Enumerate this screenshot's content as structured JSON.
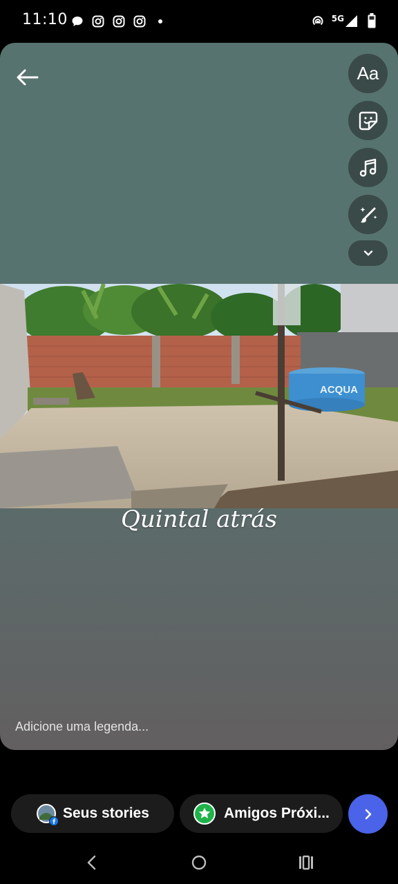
{
  "status_bar": {
    "time": "11:10",
    "network": "5G",
    "left_icons": [
      "chat-bubble-icon",
      "instagram-icon",
      "instagram-icon",
      "instagram-icon",
      "dot-icon"
    ],
    "right_icons": [
      "hotspot-icon",
      "signal-icon",
      "battery-icon"
    ]
  },
  "editor": {
    "tools": [
      {
        "name": "text-tool",
        "label": "Aa"
      },
      {
        "name": "sticker-tool",
        "icon": "sticker-icon"
      },
      {
        "name": "music-tool",
        "icon": "music-note-icon"
      },
      {
        "name": "effects-tool",
        "icon": "magic-brush-icon"
      },
      {
        "name": "more-tools",
        "icon": "chevron-down-icon"
      }
    ],
    "photo": {
      "description_icon": "photo",
      "tank_text": "ACQUA"
    },
    "overlay_text": "Quintal atrás",
    "caption_placeholder": "Adicione uma legenda..."
  },
  "share_bar": {
    "your_stories": "Seus stories",
    "close_friends": "Amigos Próxi...",
    "next_icon": "chevron-right-icon",
    "accent": "#4a63e8",
    "close_friends_color": "#1fb34a"
  },
  "nav_bar": {
    "buttons": [
      "back-nav-icon",
      "home-nav-icon",
      "recents-nav-icon"
    ]
  }
}
